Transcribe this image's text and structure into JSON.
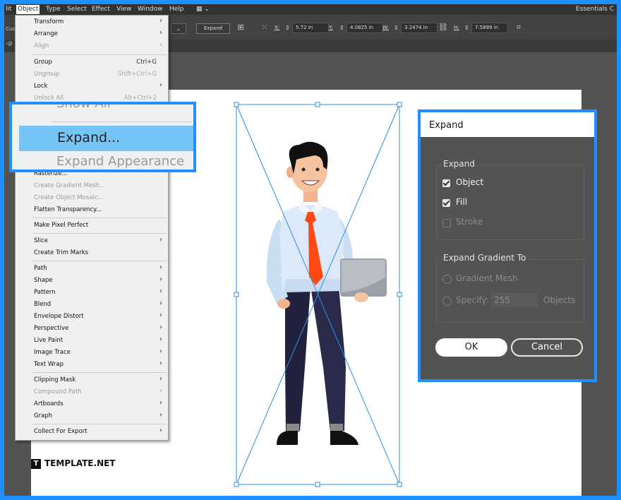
{
  "menubar": {
    "items": [
      "lit",
      "Object",
      "Type",
      "Select",
      "Effect",
      "View",
      "Window",
      "Help"
    ],
    "workspace": "Essentials C"
  },
  "controlbar": {
    "left_tag": "Cus",
    "dropdown": "⌄",
    "expand_button": "Expand",
    "x_label": "X:",
    "x_value": "5.72 in",
    "y_label": "Y:",
    "y_value": "4.0825 in",
    "w_label": "W:",
    "w_value": "3.2474 in",
    "h_label": "H:",
    "h_value": "7.5899 in"
  },
  "tabstrip": {
    "tab": "‹@"
  },
  "object_menu": {
    "items": [
      {
        "label": "Transform",
        "shortcut": "",
        "submenu": true,
        "disabled": false
      },
      {
        "label": "Arrange",
        "shortcut": "",
        "submenu": true,
        "disabled": false
      },
      {
        "label": "Align",
        "shortcut": "",
        "submenu": true,
        "disabled": true
      },
      {
        "label": "Group",
        "shortcut": "Ctrl+G",
        "submenu": false,
        "disabled": false
      },
      {
        "label": "Ungroup",
        "shortcut": "Shift+Ctrl+G",
        "submenu": false,
        "disabled": true
      },
      {
        "label": "Lock",
        "shortcut": "",
        "submenu": true,
        "disabled": false
      },
      {
        "label": "Unlock All",
        "shortcut": "Alt+Ctrl+2",
        "submenu": false,
        "disabled": true
      },
      {
        "label": "Rasterize...",
        "shortcut": "",
        "submenu": false,
        "disabled": false
      },
      {
        "label": "Create Gradient Mesh...",
        "shortcut": "",
        "submenu": false,
        "disabled": true
      },
      {
        "label": "Create Object Mosaic...",
        "shortcut": "",
        "submenu": false,
        "disabled": true
      },
      {
        "label": "Flatten Transparency...",
        "shortcut": "",
        "submenu": false,
        "disabled": false
      },
      {
        "label": "Make Pixel Perfect",
        "shortcut": "",
        "submenu": false,
        "disabled": false
      },
      {
        "label": "Slice",
        "shortcut": "",
        "submenu": true,
        "disabled": false
      },
      {
        "label": "Create Trim Marks",
        "shortcut": "",
        "submenu": false,
        "disabled": false
      },
      {
        "label": "Path",
        "shortcut": "",
        "submenu": true,
        "disabled": false
      },
      {
        "label": "Shape",
        "shortcut": "",
        "submenu": true,
        "disabled": false
      },
      {
        "label": "Pattern",
        "shortcut": "",
        "submenu": true,
        "disabled": false
      },
      {
        "label": "Blend",
        "shortcut": "",
        "submenu": true,
        "disabled": false
      },
      {
        "label": "Envelope Distort",
        "shortcut": "",
        "submenu": true,
        "disabled": false
      },
      {
        "label": "Perspective",
        "shortcut": "",
        "submenu": true,
        "disabled": false
      },
      {
        "label": "Live Paint",
        "shortcut": "",
        "submenu": true,
        "disabled": false
      },
      {
        "label": "Image Trace",
        "shortcut": "",
        "submenu": true,
        "disabled": false
      },
      {
        "label": "Text Wrap",
        "shortcut": "",
        "submenu": true,
        "disabled": false
      },
      {
        "label": "Clipping Mask",
        "shortcut": "",
        "submenu": true,
        "disabled": false
      },
      {
        "label": "Compound Path",
        "shortcut": "",
        "submenu": true,
        "disabled": true
      },
      {
        "label": "Artboards",
        "shortcut": "",
        "submenu": true,
        "disabled": false
      },
      {
        "label": "Graph",
        "shortcut": "",
        "submenu": true,
        "disabled": false
      },
      {
        "label": "Collect For Export",
        "shortcut": "",
        "submenu": true,
        "disabled": false
      }
    ]
  },
  "zoom_callout": {
    "above": "Show All",
    "highlighted": "Expand...",
    "below": "Expand Appearance"
  },
  "dialog": {
    "title": "Expand",
    "expand_group": "Expand",
    "object_label": "Object",
    "object_checked": true,
    "fill_label": "Fill",
    "fill_checked": true,
    "stroke_label": "Stroke",
    "stroke_checked": false,
    "gradient_group": "Expand Gradient To",
    "gradient_mesh_label": "Gradient Mesh",
    "specify_label": "Specify:",
    "specify_value": "255",
    "objects_label": "Objects",
    "ok_label": "OK",
    "cancel_label": "Cancel"
  },
  "watermark": {
    "logo": "T",
    "text": "TEMPLATE.NET"
  },
  "colors": {
    "accent": "#1e90ff",
    "highlight": "#74c5f6",
    "tie": "#ff4a14"
  }
}
